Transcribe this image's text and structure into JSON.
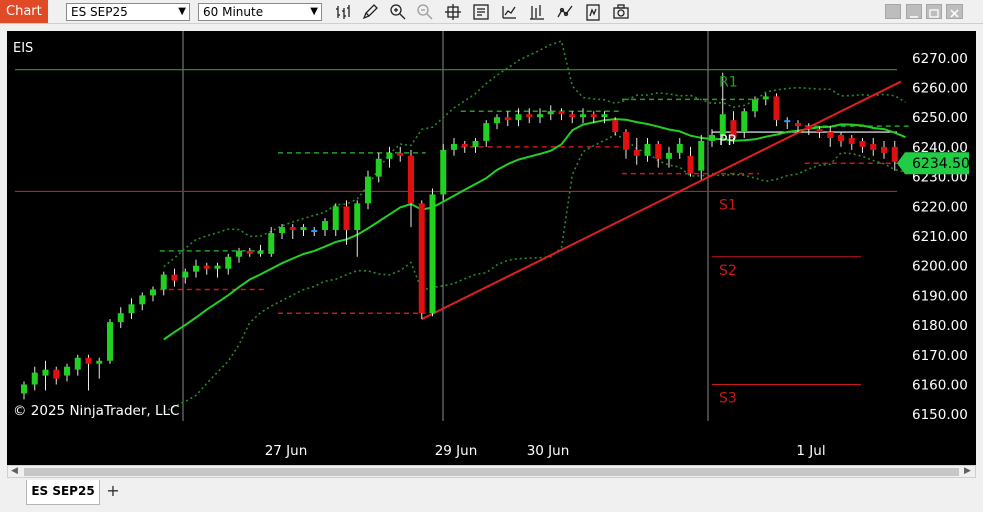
{
  "toolbar": {
    "chart_label": "Chart",
    "instrument": "ES SEP25",
    "interval": "60 Minute",
    "tools": [
      "bar-type-icon",
      "draw-pencil-icon",
      "zoom-in-icon",
      "zoom-out-icon",
      "crosshair-icon",
      "properties-icon",
      "indicators-icon",
      "strategies-icon",
      "chart-trader-icon",
      "data-box-icon",
      "snapshot-icon"
    ]
  },
  "chart": {
    "instrument_label": "EIS",
    "copyright": "© 2025 NinjaTrader, LLC",
    "last_price": "6234.50",
    "pivot_labels": {
      "r1": "R1",
      "pp": "PP",
      "s1": "S1",
      "s2": "S2",
      "s3": "S3"
    },
    "colors": {
      "background": "#000000",
      "up": "#22d022",
      "down": "#e01010",
      "doji": "#3399ff",
      "ma": "#22d022",
      "bands": "#2a8a2a",
      "trendline": "#e02020",
      "pivot_green": "#22a022",
      "pivot_red": "#c81818",
      "price_badge": "#22cc44"
    }
  },
  "chart_data": {
    "type": "candlestick",
    "title": "",
    "ylim": [
      6143,
      6277
    ],
    "y_ticks": [
      "6270.00",
      "6260.00",
      "6250.00",
      "6240.00",
      "6230.00",
      "6220.00",
      "6210.00",
      "6200.00",
      "6190.00",
      "6180.00",
      "6170.00",
      "6160.00",
      "6150.00"
    ],
    "x_ticks": [
      "27 Jun",
      "29 Jun",
      "30 Jun",
      "1 Jul"
    ],
    "last_price": 6234.5,
    "candles": [
      [
        6157,
        6160,
        6155,
        6161
      ],
      [
        6160,
        6164,
        6158,
        6166
      ],
      [
        6163,
        6165,
        6158,
        6168
      ],
      [
        6165,
        6162,
        6160,
        6166
      ],
      [
        6163,
        6166,
        6161,
        6167
      ],
      [
        6165,
        6169,
        6163,
        6170
      ],
      [
        6169,
        6167,
        6158,
        6170
      ],
      [
        6167,
        6168,
        6162,
        6169
      ],
      [
        6168,
        6181,
        6167,
        6182
      ],
      [
        6181,
        6184,
        6179,
        6186
      ],
      [
        6184,
        6187,
        6182,
        6189
      ],
      [
        6187,
        6190,
        6185,
        6191
      ],
      [
        6190,
        6192,
        6188,
        6193
      ],
      [
        6192,
        6197,
        6190,
        6198
      ],
      [
        6197,
        6195,
        6193,
        6199
      ],
      [
        6196,
        6198,
        6194,
        6199
      ],
      [
        6198,
        6200,
        6196,
        6202
      ],
      [
        6200,
        6199,
        6197,
        6201
      ],
      [
        6199,
        6200,
        6196,
        6201
      ],
      [
        6199,
        6203,
        6197,
        6204
      ],
      [
        6203,
        6205,
        6201,
        6206
      ],
      [
        6205,
        6204,
        6203,
        6206
      ],
      [
        6204,
        6205,
        6203,
        6207
      ],
      [
        6204,
        6211,
        6203,
        6213
      ],
      [
        6211,
        6213,
        6209,
        6214
      ],
      [
        6213,
        6212,
        6209,
        6214
      ],
      [
        6212,
        6213,
        6210,
        6214
      ],
      [
        6212,
        6212,
        6210,
        6213
      ],
      [
        6212,
        6215,
        6210,
        6216
      ],
      [
        6212,
        6220,
        6210,
        6221
      ],
      [
        6220,
        6212,
        6207,
        6222
      ],
      [
        6212,
        6221,
        6203,
        6222
      ],
      [
        6221,
        6230,
        6219,
        6232
      ],
      [
        6230,
        6236,
        6228,
        6238
      ],
      [
        6236,
        6238,
        6233,
        6240
      ],
      [
        6238,
        6237,
        6235,
        6240
      ],
      [
        6237,
        6221,
        6213,
        6239
      ],
      [
        6221,
        6184,
        6182,
        6222
      ],
      [
        6184,
        6224,
        6183,
        6226
      ],
      [
        6224,
        6239,
        6222,
        6241
      ],
      [
        6239,
        6241,
        6237,
        6243
      ],
      [
        6241,
        6240,
        6238,
        6242
      ],
      [
        6240,
        6242,
        6238,
        6243
      ],
      [
        6242,
        6248,
        6240,
        6249
      ],
      [
        6248,
        6250,
        6246,
        6251
      ],
      [
        6250,
        6249,
        6247,
        6252
      ],
      [
        6249,
        6251,
        6247,
        6253
      ],
      [
        6251,
        6250,
        6248,
        6253
      ],
      [
        6250,
        6251,
        6248,
        6253
      ],
      [
        6251,
        6252,
        6249,
        6254
      ],
      [
        6252,
        6251,
        6249,
        6253
      ],
      [
        6251,
        6250,
        6248,
        6252
      ],
      [
        6250,
        6251,
        6248,
        6253
      ],
      [
        6251,
        6250,
        6248,
        6252
      ],
      [
        6250,
        6251,
        6248,
        6252
      ],
      [
        6249,
        6245,
        6244,
        6250
      ],
      [
        6245,
        6239,
        6236,
        6246
      ],
      [
        6239,
        6237,
        6234,
        6243
      ],
      [
        6237,
        6241,
        6235,
        6243
      ],
      [
        6241,
        6236,
        6233,
        6242
      ],
      [
        6236,
        6238,
        6233,
        6240
      ],
      [
        6238,
        6241,
        6236,
        6243
      ],
      [
        6237,
        6231,
        6230,
        6240
      ],
      [
        6232,
        6242,
        6229,
        6244
      ],
      [
        6242,
        6244,
        6240,
        6246
      ],
      [
        6244,
        6251,
        6243,
        6265
      ],
      [
        6249,
        6243,
        6241,
        6252
      ],
      [
        6245,
        6252,
        6243,
        6253
      ],
      [
        6252,
        6256,
        6250,
        6257
      ],
      [
        6256,
        6257,
        6254,
        6258
      ],
      [
        6257,
        6249,
        6247,
        6258
      ],
      [
        6249,
        6249,
        6246,
        6250
      ],
      [
        6248,
        6247,
        6245,
        6249
      ],
      [
        6247,
        6246,
        6244,
        6248
      ],
      [
        6246,
        6245,
        6243,
        6247
      ],
      [
        6245,
        6243,
        6240,
        6247
      ],
      [
        6244,
        6242,
        6240,
        6245
      ],
      [
        6243,
        6241,
        6239,
        6244
      ],
      [
        6242,
        6240,
        6238,
        6243
      ],
      [
        6241,
        6239,
        6237,
        6243
      ],
      [
        6240,
        6238,
        6236,
        6242
      ],
      [
        6240,
        6235,
        6232,
        6242
      ],
      [
        6235,
        6234.5,
        6233,
        6237
      ]
    ],
    "pivots": {
      "R1": 6266,
      "PP": 6245,
      "S1": 6225,
      "S2": 6203,
      "S3": 6160
    }
  }
}
